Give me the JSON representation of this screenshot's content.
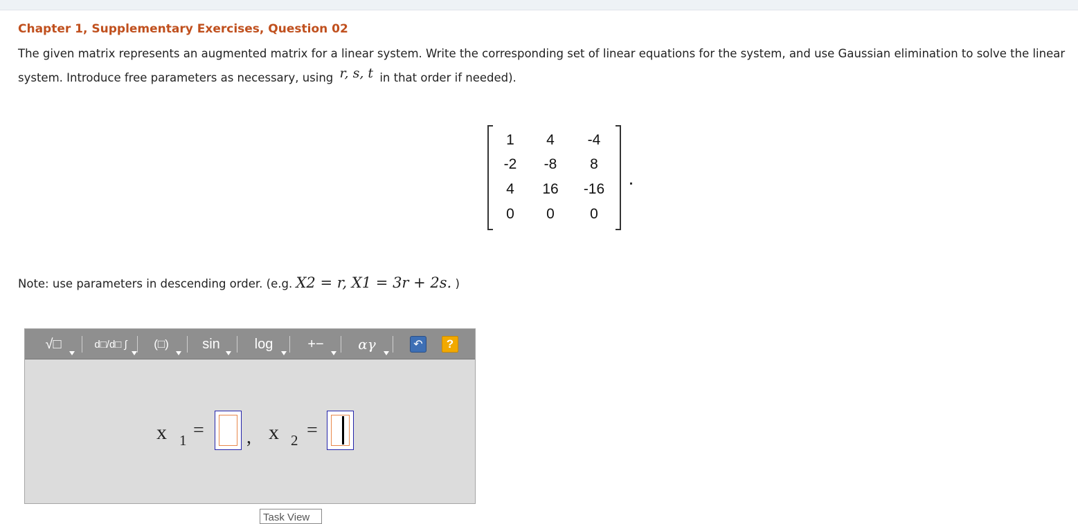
{
  "question": {
    "title": "Chapter 1, Supplementary Exercises, Question 02",
    "prompt_part1": "The given matrix represents an augmented matrix for a linear system. Write the corresponding set of linear equations for the system, and use Gaussian elimination to solve the linear system. Introduce free parameters as necessary, using",
    "params": "r, s, t",
    "prompt_part2": "in that order if needed)."
  },
  "matrix": {
    "rows": [
      [
        "1",
        "4",
        "-4"
      ],
      [
        "-2",
        "-8",
        "8"
      ],
      [
        "4",
        "16",
        "-16"
      ],
      [
        "0",
        "0",
        "0"
      ]
    ],
    "trailing_mark": "."
  },
  "note": {
    "text": "Note: use parameters in descending order. (e.g.",
    "example": "X2 = r, X1 = 3r + 2s.",
    "close": ")"
  },
  "toolbar": {
    "items": [
      {
        "name": "templates-menu",
        "icon": "sqrt-template-icon",
        "label": "√□"
      },
      {
        "name": "calculus-menu",
        "icon": "derivative-template-icon",
        "label": "d□/d□ ∫"
      },
      {
        "name": "brackets-menu",
        "icon": "bracket-template-icon",
        "label": "(□)"
      },
      {
        "name": "trig-menu",
        "icon": "trig-icon",
        "label": "sin"
      },
      {
        "name": "log-menu",
        "icon": "log-icon",
        "label": "log"
      },
      {
        "name": "operators-menu",
        "icon": "plus-minus-icon",
        "label": "+−"
      },
      {
        "name": "greek-menu",
        "icon": "greek-icon",
        "label": "αγ"
      }
    ],
    "undo_icon": "undo-icon",
    "help_label": "?"
  },
  "answer": {
    "var1": "x",
    "sub1": "1",
    "var2": "x",
    "sub2": "2",
    "equals": "=",
    "comma": ","
  },
  "footer": {
    "task_view": "Task View"
  },
  "colors": {
    "title": "#c0501e",
    "toolbar_bg": "#8f8f8f",
    "editor_bg": "#dcdcdc",
    "help_button": "#f2a900",
    "undo_button": "#3d6fb5"
  }
}
